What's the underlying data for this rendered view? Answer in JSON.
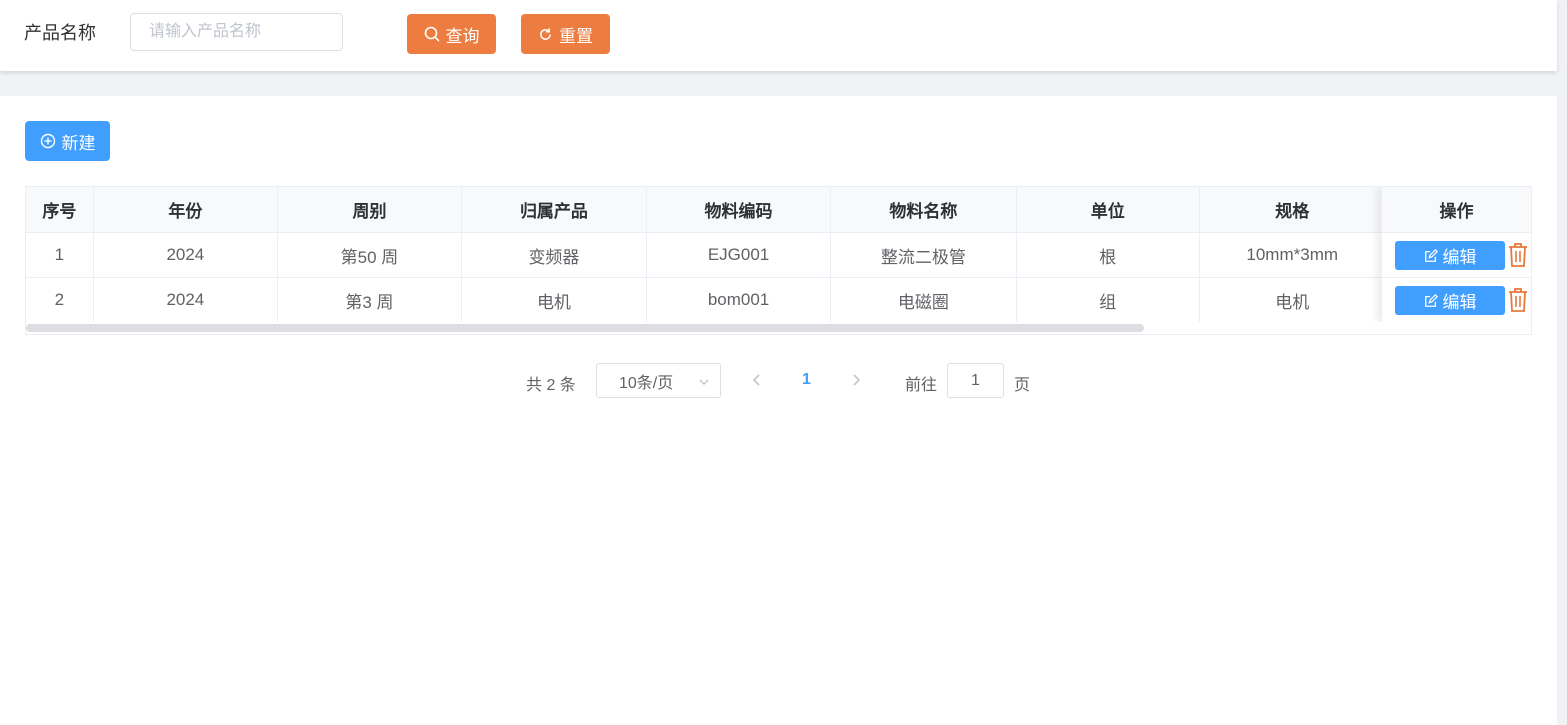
{
  "search": {
    "label": "产品名称",
    "placeholder": "请输入产品名称",
    "value": "",
    "query_label": "查询",
    "reset_label": "重置"
  },
  "toolbar": {
    "new_label": "新建"
  },
  "table": {
    "headers": [
      "序号",
      "年份",
      "周别",
      "归属产品",
      "物料编码",
      "物料名称",
      "单位",
      "规格"
    ],
    "op_header": "操作",
    "rows": [
      [
        "1",
        "2024",
        "第50 周",
        "变频器",
        "EJG001",
        "整流二极管",
        "根",
        "10mm*3mm"
      ],
      [
        "2",
        "2024",
        "第3 周",
        "电机",
        "bom001",
        "电磁圈",
        "组",
        "电机"
      ]
    ],
    "edit_label": "编辑"
  },
  "pagination": {
    "total": "共 2 条",
    "page_size": "10条/页",
    "current_page": "1",
    "goto_label": "前往",
    "goto_value": "1",
    "page_unit": "页"
  },
  "colors": {
    "primary": "#409eff",
    "accent_orange": "#ed7c40",
    "danger_icon": "#e6783c"
  },
  "icons": {
    "query": "search-icon",
    "reset": "refresh-icon",
    "new": "plus-circle-icon",
    "edit": "edit-icon",
    "delete": "trash-icon"
  }
}
